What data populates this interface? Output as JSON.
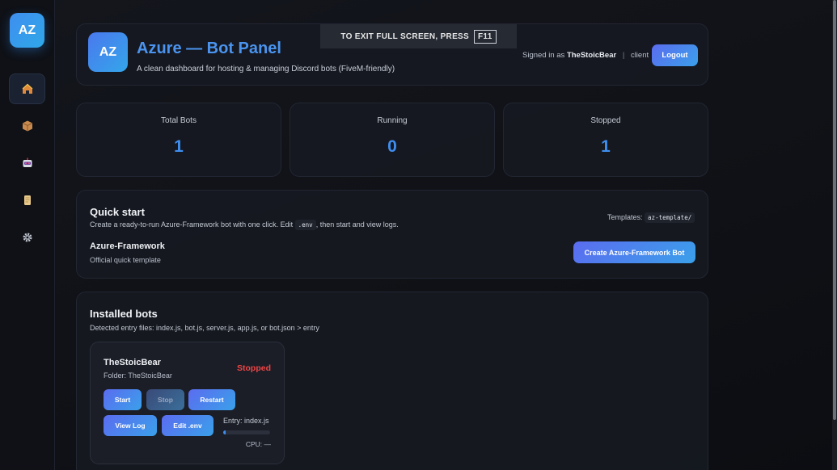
{
  "sidebar": {
    "logo": "AZ",
    "items": [
      {
        "name": "home-icon",
        "glyph": "🏠",
        "active": true
      },
      {
        "name": "package-icon",
        "glyph": "📦"
      },
      {
        "name": "robot-icon",
        "glyph": "🤖"
      },
      {
        "name": "scroll-icon",
        "glyph": "📜"
      },
      {
        "name": "gear-icon",
        "glyph": "⚙"
      }
    ]
  },
  "header": {
    "avatar": "AZ",
    "title": "Azure — Bot Panel",
    "subtitle": "A clean dashboard for hosting & managing Discord bots (FiveM-friendly)",
    "signed_prefix": "Signed in as",
    "user": "TheStoicBear",
    "separator": "|",
    "role": "client",
    "logout": "Logout"
  },
  "fullscreen_notice": {
    "text": "TO EXIT FULL SCREEN, PRESS",
    "key": "F11"
  },
  "stats": [
    {
      "label": "Total Bots",
      "value": "1"
    },
    {
      "label": "Running",
      "value": "0"
    },
    {
      "label": "Stopped",
      "value": "1"
    }
  ],
  "quick_start": {
    "title": "Quick start",
    "desc_before": "Create a ready-to-run Azure-Framework bot with one click. Edit",
    "desc_code": ".env",
    "desc_after": ", then start and view logs.",
    "templates_label": "Templates:",
    "templates_code": "az-template/",
    "template_name": "Azure-Framework",
    "template_sub": "Official quick template",
    "create_button": "Create Azure-Framework Bot"
  },
  "installed": {
    "title": "Installed bots",
    "desc": "Detected entry files: index.js, bot.js, server.js, app.js, or bot.json > entry",
    "bots": [
      {
        "name": "TheStoicBear",
        "folder": "Folder: TheStoicBear",
        "status": "Stopped",
        "status_color": "#ef4444",
        "start": "Start",
        "stop": "Stop",
        "restart": "Restart",
        "view_log": "View Log",
        "edit_env": "Edit .env",
        "entry": "Entry: index.js",
        "cpu": "CPU: —",
        "cpu_fraction": 0.05
      }
    ]
  },
  "colors": {
    "accent": "#3f8ef0",
    "stopped": "#ef4444",
    "background": "#0f1116"
  }
}
